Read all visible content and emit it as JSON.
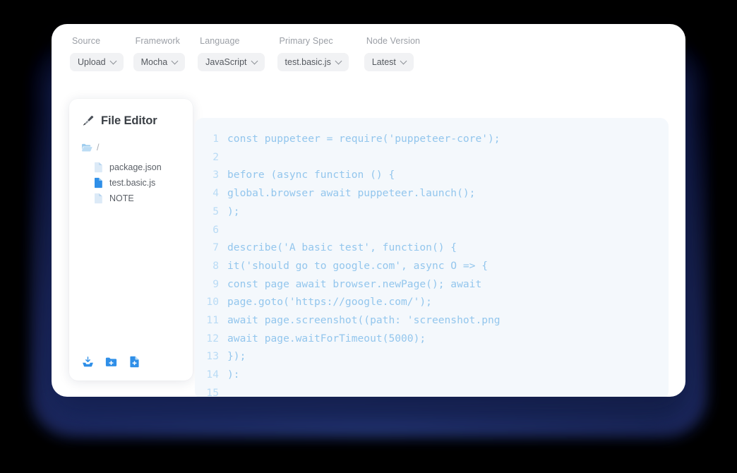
{
  "theme": {
    "page_background": "#000000",
    "navy_slab": "#1d2c6b",
    "card_background": "#ffffff",
    "pill_background": "#f1f2f4",
    "pill_text": "#55595f",
    "label_text": "#9b9fa6",
    "code_panel_background": "#f4f8fc",
    "code_text": "#93c6ed",
    "line_number_text": "#b9dbf5",
    "accent_blue": "#2f8fe8",
    "file_icon_pale": "#cfe5f8",
    "file_icon_active": "#2f8fe8",
    "folder_icon": "#9fcdee"
  },
  "toolbar": {
    "fields": [
      {
        "label": "Source",
        "value": "Upload",
        "icon": "chevron-down-icon"
      },
      {
        "label": "Framework",
        "value": "Mocha",
        "icon": "chevron-down-icon"
      },
      {
        "label": "Language",
        "value": "JavaScript",
        "icon": "chevron-down-icon"
      },
      {
        "label": "Primary Spec",
        "value": "test.basic.js",
        "icon": "chevron-down-icon"
      },
      {
        "label": "Node Version",
        "value": "Latest",
        "icon": "chevron-down-icon"
      }
    ]
  },
  "sidebar": {
    "title": "File Editor",
    "title_icon": "paintbrush-icon",
    "root": {
      "icon": "open-folder-icon",
      "label": "/"
    },
    "files": [
      {
        "name": "package.json",
        "icon": "file-icon",
        "active": false
      },
      {
        "name": "test.basic.js",
        "icon": "file-icon",
        "active": true
      },
      {
        "name": "NOTE",
        "icon": "file-icon",
        "active": false
      }
    ],
    "actions": [
      {
        "icon": "upload-icon",
        "title": "Upload file"
      },
      {
        "icon": "new-folder-icon",
        "title": "New folder"
      },
      {
        "icon": "new-file-icon",
        "title": "New file"
      }
    ]
  },
  "editor": {
    "lines": [
      {
        "n": "1",
        "text": "const puppeteer = require('puppeteer-core');"
      },
      {
        "n": "2",
        "text": ""
      },
      {
        "n": "3",
        "text": "before (async function () {"
      },
      {
        "n": "4",
        "text": "global.browser await puppeteer.launch();"
      },
      {
        "n": "5",
        "text": ");"
      },
      {
        "n": "6",
        "text": ""
      },
      {
        "n": "7",
        "text": "describe('A basic test', function() {"
      },
      {
        "n": "8",
        "text": "it('should go to google.com', async O => {"
      },
      {
        "n": "9",
        "text": "const page await browser.newPage(); await"
      },
      {
        "n": "10",
        "text": "page.goto('https://google.com/');"
      },
      {
        "n": "11",
        "text": "await page.screenshot((path: 'screenshot.png"
      },
      {
        "n": "12",
        "text": "await page.waitForTimeout(5000);"
      },
      {
        "n": "13",
        "text": "});"
      },
      {
        "n": "14",
        "text": "):"
      },
      {
        "n": "15",
        "text": ""
      }
    ]
  }
}
